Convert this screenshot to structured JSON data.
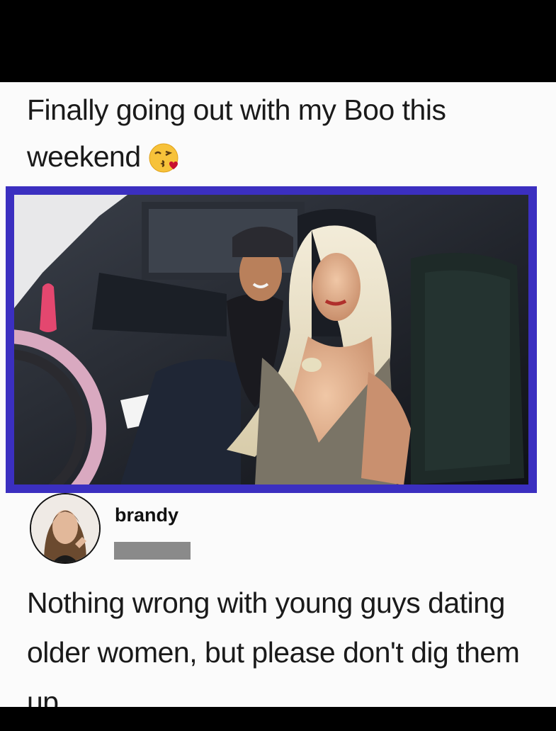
{
  "post": {
    "caption": "Finally going out with my Boo this weekend",
    "emoji_icon": "face-blowing-a-kiss-emoji"
  },
  "comment": {
    "username": "brandy",
    "text": "Nothing wrong with young guys dating older women, but please don't dig them up."
  },
  "colors": {
    "frame": "#3b2fc0",
    "redaction": "#8a8a8a",
    "background": "#fbfbfb"
  }
}
